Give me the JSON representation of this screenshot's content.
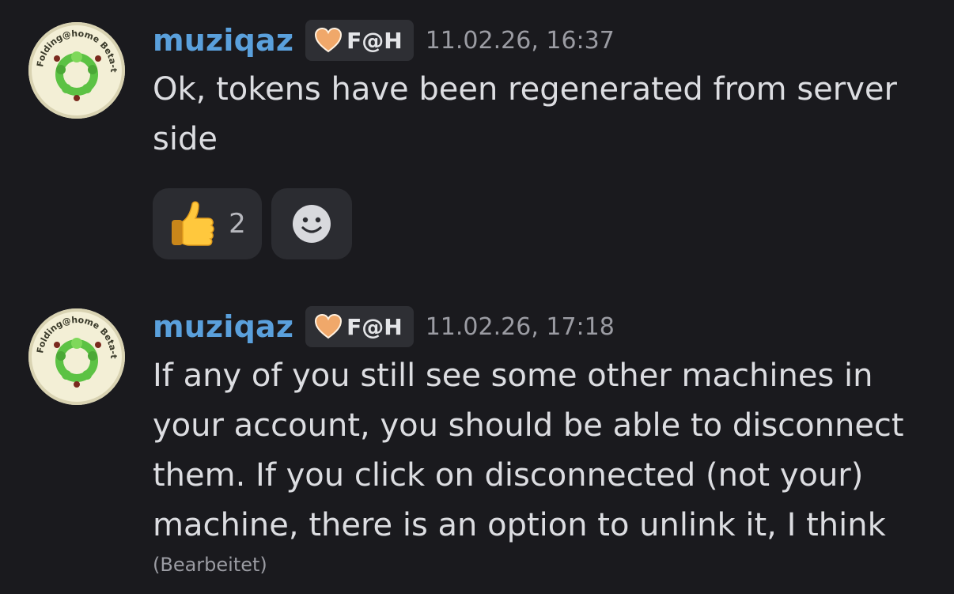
{
  "messages": [
    {
      "username": "muziqaz",
      "tag": "F@H",
      "timestamp": "11.02.26, 16:37",
      "text": "Ok, tokens have been regenerated from server side",
      "avatar_text": "Folding@home Beta-tester",
      "reactions": [
        {
          "emoji": "thumbs-up",
          "count": "2"
        }
      ]
    },
    {
      "username": "muziqaz",
      "tag": "F@H",
      "timestamp": "11.02.26, 17:18",
      "text": "If any of you still see some other machines in your account, you should be able to disconnect them. If you click on disconnected (not your) machine, there is an option to unlink it, I think",
      "edited_label": "(Bearbeitet)",
      "avatar_text": "Folding@home Beta-tester"
    }
  ],
  "colors": {
    "background": "#1a1a1e",
    "username": "#5aa0dc",
    "tag_background": "#2e2f34",
    "heart": "#f0a86a",
    "reaction_background": "#2b2c31"
  }
}
